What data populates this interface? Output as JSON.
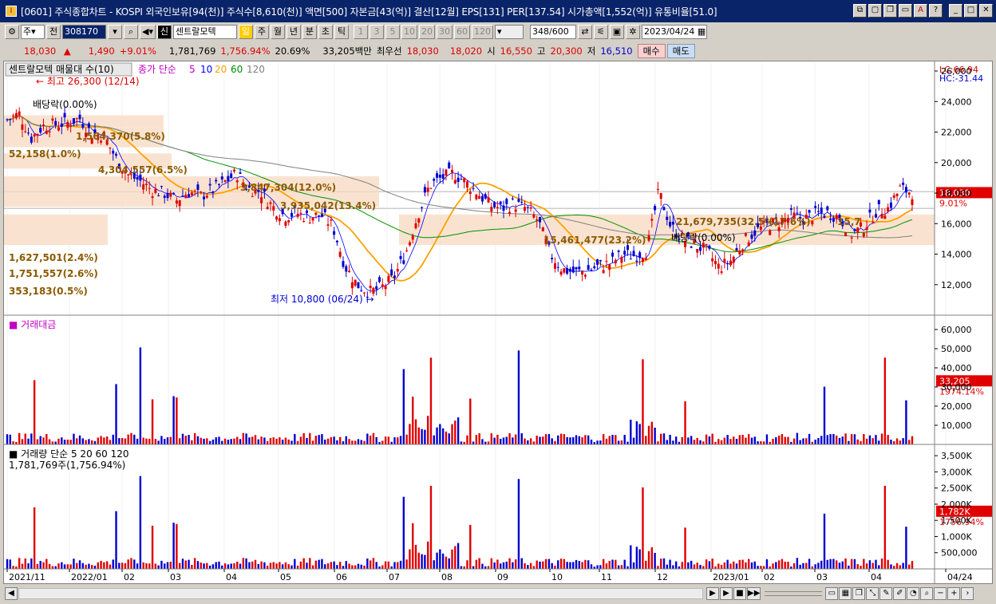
{
  "window": {
    "title": "[0601] 주식종합차트 - KOSPI 외국인보유[94(천)] 주식수[8,610(천)] 액면[500] 자본금[43(억)] 결산[12월] EPS[131] PER[137.54] 시가총액[1,552(억)] 유통비율[51.0]",
    "icon": "app-icon",
    "buttons": [
      "restore-icon",
      "window-icon",
      "copy-icon",
      "link-icon",
      "font-icon",
      "help-icon",
      "minimize-icon",
      "maximize-icon",
      "close-icon"
    ]
  },
  "toolbar": {
    "period_select": "주",
    "prev_label": "전",
    "code": "308170",
    "name": "센트랄모텍",
    "period_buttons": [
      "일",
      "주",
      "월",
      "년",
      "분",
      "초",
      "틱"
    ],
    "num_buttons": [
      "1",
      "3",
      "5",
      "10",
      "20",
      "30",
      "60",
      "120"
    ],
    "count": "348",
    "count_total": "/600",
    "date": "2023/04/24",
    "sin_label": "신"
  },
  "quote": {
    "price": "18,030",
    "arrow": "▲",
    "change": "1,490",
    "change_pct": "+9.01%",
    "volume": "1,781,769",
    "volume_pct": "1,756.94%",
    "turnover": "20.69%",
    "amount": "33,205백만",
    "best_label": "최우선",
    "ask": "18,030",
    "bid": "18,020",
    "open_label": "시",
    "open": "16,550",
    "high_label": "고",
    "high": "20,300",
    "low_label": "저",
    "low": "16,510",
    "buy": "매수",
    "sell": "매도"
  },
  "colors": {
    "up": "#e00000",
    "down": "#0000d0",
    "ma5": "#0000ff",
    "ma10": "#ff3030",
    "ma20": "#ffa000",
    "ma60": "#009000",
    "ma120": "#808080",
    "band": "#f7dcc4",
    "title_bg": "#0a246a"
  },
  "chart_data": {
    "type": "candlestick",
    "x_ticks": [
      "2021/11",
      "2022/01",
      "02",
      "03",
      "04",
      "05",
      "06",
      "07",
      "08",
      "09",
      "10",
      "11",
      "12",
      "2023/01",
      "02",
      "03",
      "04",
      "04/24"
    ],
    "price_pane": {
      "legend_name": "센트랄모텍 매물대 수(10)",
      "ma_label": "종가 단순",
      "ma_periods": [
        "5",
        "10",
        "20",
        "60",
        "120"
      ],
      "ylim": [
        10000,
        26000
      ],
      "y_ticks": [
        "26,000",
        "24,000",
        "22,000",
        "20,000",
        "18,000",
        "16,000",
        "14,000",
        "12,000"
      ],
      "lc": "LC:66.94",
      "hc": "HC:-31.44",
      "last_price": "18,030",
      "last_pct": "9.01%",
      "max_label": "최고 26,300 (12/14)",
      "min_label": "최저 10,800 (06/24)",
      "dividend_labels": [
        "배당락(0.00%)",
        "배당락(0.00%)"
      ],
      "volume_profile_labels": [
        "52,158(1.0%)",
        "1,564,370(5.8%)",
        "4,304,557(6.5%)",
        "3,847,304(12.0%)",
        "3,935,042(13.4%)",
        "1,627,501(2.4%)",
        "1,751,557(2.6%)",
        "353,183(0.5%)",
        "15,461,477(23.2%)",
        "21,679,735(32.5%)",
        "(17.6%)",
        "15,7"
      ]
    },
    "amount_pane": {
      "title": "거래대금",
      "y_ticks": [
        "60,000",
        "50,000",
        "40,000",
        "30,000",
        "20,000",
        "10,000"
      ],
      "last": "33,205",
      "last_pct": "1974.14%",
      "spikes": [
        25,
        39,
        48,
        60,
        38,
        18,
        56,
        40,
        55,
        23,
        30,
        48,
        38,
        35
      ]
    },
    "volume_pane": {
      "title": "거래량",
      "ma_label": "단순",
      "ma_periods": [
        "5",
        "20",
        "60",
        "120"
      ],
      "sub": "1,781,769주(1,756.94%)",
      "y_ticks": [
        "3,500K",
        "3,000K",
        "2,500K",
        "2,000K",
        "1,500K",
        "1,000K",
        "500,000"
      ],
      "last": "1,782K",
      "last_pct": "1756.94%"
    },
    "series_approx_close": [
      22800,
      23200,
      21600,
      22400,
      22500,
      22600,
      22900,
      21900,
      21800,
      20300,
      19200,
      18800,
      18200,
      18000,
      17500,
      18100,
      17800,
      18200,
      18700,
      19300,
      18300,
      18100,
      17100,
      16500,
      16700,
      16400,
      16600,
      15800,
      13200,
      12000,
      11500,
      11800,
      12400,
      14000,
      16500,
      18500,
      19000,
      19300,
      18700,
      18000,
      17200,
      17000,
      17300,
      17000,
      16200,
      14000,
      13000,
      12800,
      12900,
      13200,
      13400,
      14000,
      13900,
      14200,
      18100,
      15800,
      15000,
      14600,
      14200,
      13100,
      13600,
      14800,
      15500,
      15900,
      16100,
      16500,
      16300,
      16600,
      16700,
      16400,
      15300,
      15800,
      16800,
      17000,
      18300,
      18030
    ]
  },
  "bottom": {
    "buttons": [
      "prev-icon",
      "stop-icon",
      "next-icon",
      "zoom-out-icon",
      "zoom-in-icon"
    ],
    "minus": "−",
    "plus": "+"
  }
}
